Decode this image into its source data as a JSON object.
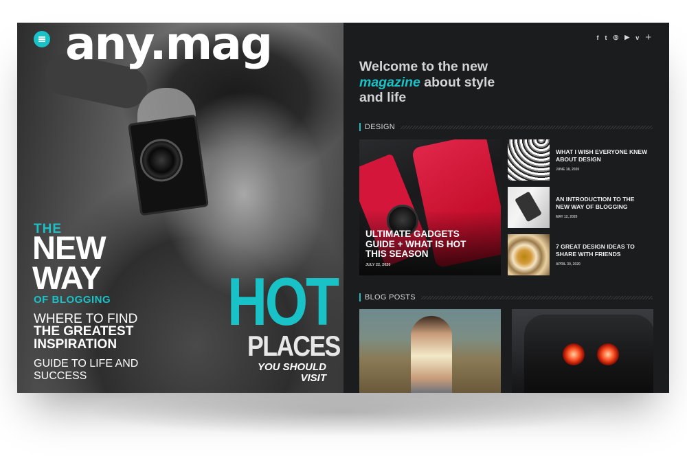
{
  "brand": {
    "logo": "any.mag",
    "accent": "#19c2c7",
    "background": "#1b1c1e"
  },
  "cover": {
    "the": "THE",
    "new": "NEW",
    "way": "WAY",
    "of_blogging": "OF BLOGGING",
    "where_to_find": "WHERE TO FIND",
    "greatest_inspiration": "THE GREATEST INSPIRATION",
    "guide": "GUIDE TO LIFE AND SUCCESS",
    "hot": "HOT",
    "places": "PLACES",
    "you_should": "YOU SHOULD",
    "visit": "VISIT"
  },
  "header": {
    "menu_icon": "hamburger-icon",
    "social": [
      "f",
      "t",
      "◎",
      "▶",
      "v",
      "+"
    ]
  },
  "hero": {
    "line1": "Welcome to the new",
    "accent": "magazine",
    "line2_rest": " about style",
    "line3": "and life"
  },
  "design": {
    "label": "DESIGN",
    "featured": {
      "title": "ULTIMATE GADGETS GUIDE + WHAT IS HOT THIS SEASON",
      "date": "JULY 22, 2020"
    },
    "posts": [
      {
        "title": "WHAT I WISH EVERYONE KNEW ABOUT DESIGN",
        "date": "JUNE 18, 2020"
      },
      {
        "title": "AN INTRODUCTION TO THE NEW WAY OF BLOGGING",
        "date": "MAY 12, 2020"
      },
      {
        "title": "7 GREAT DESIGN IDEAS TO SHARE WITH FRIENDS",
        "date": "APRIL 30, 2020"
      }
    ]
  },
  "blog": {
    "label": "BLOG POSTS"
  }
}
